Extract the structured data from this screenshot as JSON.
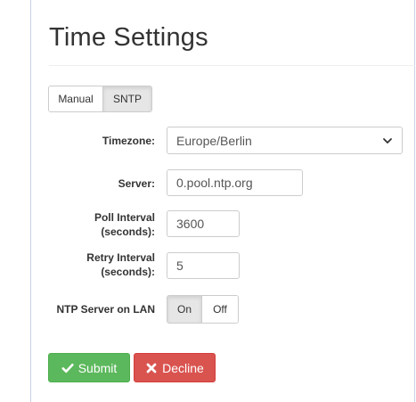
{
  "page": {
    "title": "Time Settings"
  },
  "mode_toggle": {
    "options": [
      "Manual",
      "SNTP"
    ],
    "active": "SNTP"
  },
  "form": {
    "timezone": {
      "label": "Timezone:",
      "value": "Europe/Berlin"
    },
    "server": {
      "label": "Server:",
      "value": "0.pool.ntp.org"
    },
    "poll_interval": {
      "label_line1": "Poll Interval",
      "label_line2": "(seconds):",
      "value": "3600"
    },
    "retry_interval": {
      "label_line1": "Retry Interval",
      "label_line2": "(seconds):",
      "value": "5"
    },
    "ntp_server_lan": {
      "label": "NTP Server on LAN",
      "options": [
        "On",
        "Off"
      ],
      "active": "On"
    }
  },
  "actions": {
    "submit_label": "Submit",
    "decline_label": "Decline"
  },
  "colors": {
    "submit": "#5cb85c",
    "decline": "#d9534f"
  },
  "icons": {
    "submit": "check-icon",
    "decline": "x-icon",
    "select": "chevron-down-icon"
  }
}
